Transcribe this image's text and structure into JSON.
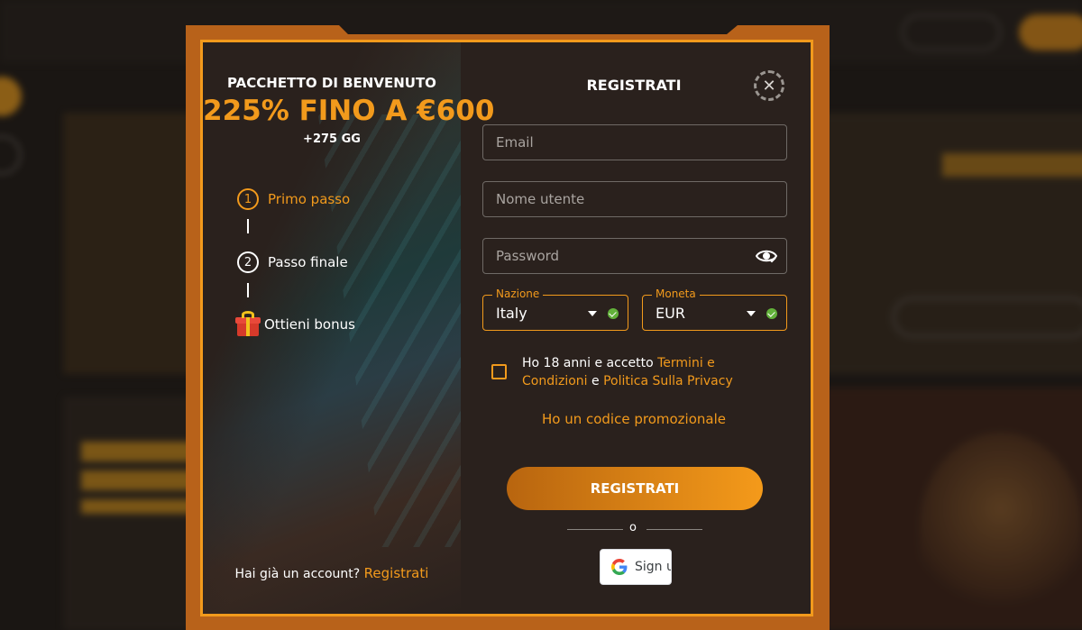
{
  "promo": {
    "subtitle": "PACCHETTO DI BENVENUTO",
    "title": "225% FINO A €600",
    "extra": "+275 GG",
    "steps": [
      {
        "num": "1",
        "label": "Primo passo"
      },
      {
        "num": "2",
        "label": "Passo finale"
      },
      {
        "label": "Ottieni bonus",
        "icon": "gift-icon"
      }
    ],
    "account_question": "Hai già un account?",
    "account_link": "Registrati"
  },
  "form": {
    "title": "REGISTRATI",
    "email_placeholder": "Email",
    "username_placeholder": "Nome utente",
    "password_placeholder": "Password",
    "nation": {
      "label": "Nazione",
      "value": "Italy"
    },
    "currency": {
      "label": "Moneta",
      "value": "EUR"
    },
    "terms_prefix": "Ho 18 anni e accetto ",
    "terms_link": "Termini e Condizioni",
    "terms_mid": " e ",
    "privacy_link": "Politica Sulla Privacy",
    "promo_code_link": "Ho un codice promozionale",
    "submit_label": "REGISTRATI",
    "or_text": "o",
    "google_label": "Sign u"
  },
  "colors": {
    "accent": "#f29a1c",
    "modal_bg": "#2a211d",
    "valid_green": "#62b13a"
  },
  "icons": {
    "close": "close-icon",
    "eye": "eye-icon",
    "caret": "chevron-down-icon",
    "check": "check-circle-icon",
    "google": "google-icon"
  }
}
